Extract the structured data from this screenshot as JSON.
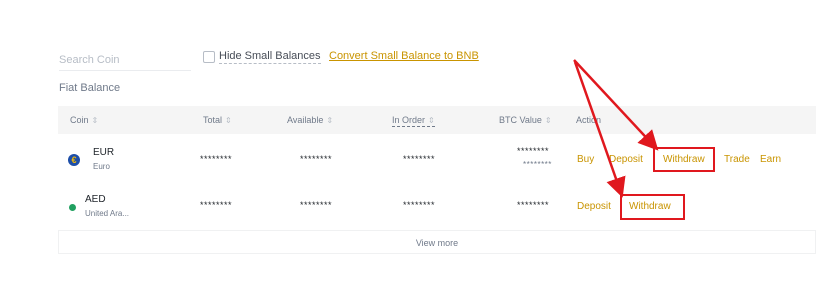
{
  "search": {
    "placeholder": "Search Coin"
  },
  "filters": {
    "hide_small_label": "Hide Small Balances",
    "convert_label": "Convert Small Balance to BNB"
  },
  "section_title": "Fiat Balance",
  "table": {
    "columns": [
      "Coin",
      "Total",
      "Available",
      "In Order",
      "BTC Value",
      "Action"
    ],
    "rows": [
      {
        "symbol": "EUR",
        "name": "Euro",
        "icon": "euro-icon",
        "total": "********",
        "available": "********",
        "in_order": "********",
        "btc_value": "********",
        "btc_value_sub": "********",
        "actions": [
          "Buy",
          "Deposit",
          "Withdraw",
          "Trade",
          "Earn"
        ]
      },
      {
        "symbol": "AED",
        "name": "United Ara...",
        "icon": "aed-icon",
        "total": "********",
        "available": "********",
        "in_order": "********",
        "btc_value": "********",
        "actions": [
          "Deposit",
          "Withdraw"
        ]
      }
    ],
    "view_more": "View more"
  },
  "colors": {
    "accent": "#c99400",
    "annotation": "#e0181e",
    "header_bg": "#f5f5f5"
  }
}
